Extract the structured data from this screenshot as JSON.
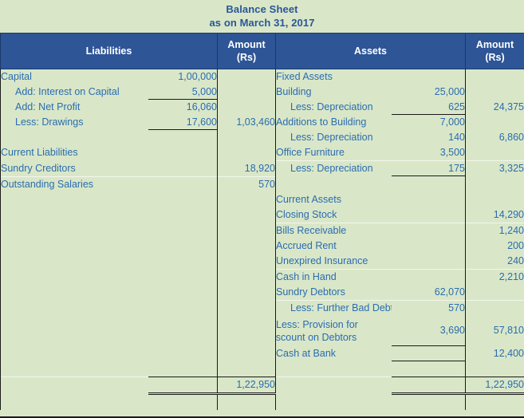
{
  "title": {
    "line1": "Balance Sheet",
    "line2": "as on March 31, 2017"
  },
  "colors": {
    "header_blue": "#2e5596",
    "page_bg": "#d9e7c8",
    "text_blue": "#2b6cb0",
    "title_blue": "#2a5699",
    "rule": "#1a1a1a"
  },
  "headers": {
    "liabilities": "Liabilities",
    "amount_left_line1": "Amount",
    "amount_left_line2": "(Rs)",
    "assets": "Assets",
    "amount_right_line1": "Amount",
    "amount_right_line2": "(Rs)"
  },
  "liabilities": [
    {
      "label": "Capital",
      "sub": "1,00,000",
      "amount": ""
    },
    {
      "label": "Add: Interest on Capital",
      "sub": "5,000",
      "amount": "",
      "indent": true,
      "sub_underline": true
    },
    {
      "label": "Add: Net Profit",
      "sub": "16,060",
      "amount": "",
      "indent": true
    },
    {
      "label": "Less: Drawings",
      "sub": "17,600",
      "amount": "1,03,460",
      "indent": true,
      "sub_underline": true
    },
    {
      "label": "",
      "sub": "",
      "amount": ""
    },
    {
      "label": "Current Liabilities",
      "sub": "",
      "amount": ""
    },
    {
      "label": "Sundry Creditors",
      "sub": "",
      "amount": "18,920"
    },
    {
      "label": "Outstanding Salaries",
      "sub": "",
      "amount": "570",
      "separator": true
    },
    {
      "label": "",
      "sub": "",
      "amount": ""
    },
    {
      "label": "",
      "sub": "",
      "amount": ""
    },
    {
      "label": "",
      "sub": "",
      "amount": ""
    },
    {
      "label": "",
      "sub": "",
      "amount": ""
    },
    {
      "label": "",
      "sub": "",
      "amount": ""
    },
    {
      "label": "",
      "sub": "",
      "amount": ""
    },
    {
      "label": "",
      "sub": "",
      "amount": ""
    },
    {
      "label": "",
      "sub": "",
      "amount": ""
    },
    {
      "label": "",
      "sub": "",
      "amount": ""
    },
    {
      "label": "",
      "sub": "",
      "amount": ""
    },
    {
      "label": "",
      "sub": "",
      "amount": ""
    },
    {
      "label": "",
      "sub": "",
      "amount": ""
    }
  ],
  "assets": [
    {
      "label": "Fixed Assets",
      "sub": "",
      "amount": ""
    },
    {
      "label": "Building",
      "sub": "25,000",
      "amount": ""
    },
    {
      "label": "Less: Depreciation",
      "sub": "625",
      "amount": "24,375",
      "indent": true,
      "sub_underline": true
    },
    {
      "label": "Additions to Building",
      "sub": "7,000",
      "amount": ""
    },
    {
      "label": "Less: Depreciation",
      "sub": "140",
      "amount": "6,860",
      "indent": true
    },
    {
      "label": "Office Furniture",
      "sub": "3,500",
      "amount": ""
    },
    {
      "label": "Less: Depreciation",
      "sub": "175",
      "amount": "3,325",
      "indent": true,
      "sub_underline": true,
      "separator": true
    },
    {
      "label": "",
      "sub": "",
      "amount": ""
    },
    {
      "label": "Current Assets",
      "sub": "",
      "amount": ""
    },
    {
      "label": "Closing Stock",
      "sub": "",
      "amount": "14,290"
    },
    {
      "label": "Bills Receivable",
      "sub": "",
      "amount": "1,240",
      "separator": true
    },
    {
      "label": "Accrued Rent",
      "sub": "",
      "amount": "200"
    },
    {
      "label": "Unexpired Insurance",
      "sub": "",
      "amount": "240"
    },
    {
      "label": "Cash in Hand",
      "sub": "",
      "amount": "2,210",
      "separator": true
    },
    {
      "label": "Sundry Debtors",
      "sub": "62,070",
      "amount": ""
    },
    {
      "label": "Less: Further Bad Debts",
      "sub": "570",
      "amount": "",
      "indent": true,
      "separator": true
    }
  ],
  "assets_wrapped_row": {
    "label_line1": "Less: Provision for",
    "label_line2": "Discount on Debtors",
    "sub": "3,690",
    "amount": "57,810"
  },
  "assets_tail": [
    {
      "label": "Cash at Bank",
      "sub": "",
      "amount": "12,400",
      "sub_underline": true
    }
  ],
  "totals": {
    "liabilities_total": "1,22,950",
    "assets_total": "1,22,950"
  }
}
